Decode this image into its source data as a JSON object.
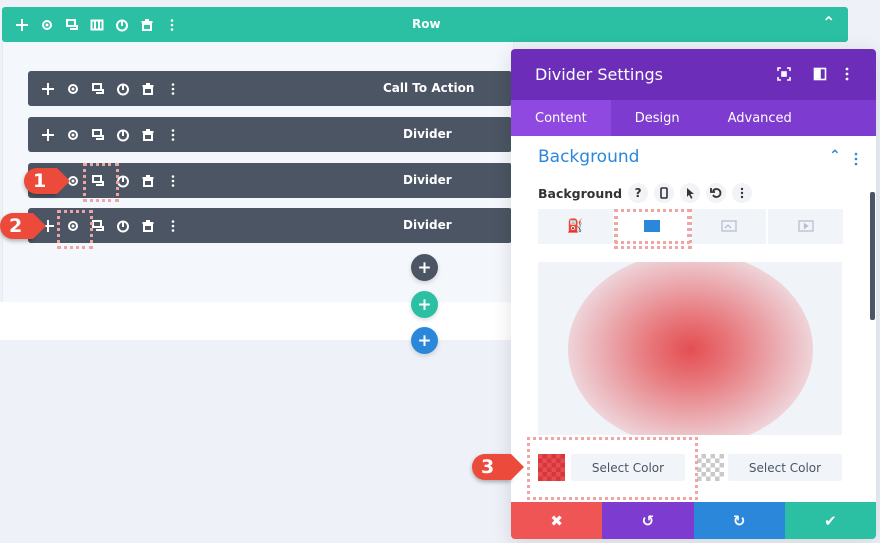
{
  "row": {
    "label": "Row",
    "color": "#2bbfa3",
    "icons": [
      "move-icon",
      "gear-icon",
      "duplicate-icon",
      "columns-icon",
      "power-icon",
      "trash-icon",
      "more-icon"
    ]
  },
  "modules": [
    {
      "label": "Call To Action"
    },
    {
      "label": "Divider"
    },
    {
      "label": "Divider"
    },
    {
      "label": "Divider"
    }
  ],
  "add_buttons": [
    {
      "label": "+",
      "color": "#4b5563",
      "kind": "add-module"
    },
    {
      "label": "+",
      "color": "#2bbfa3",
      "kind": "add-row"
    },
    {
      "label": "+",
      "color": "#2b87da",
      "kind": "add-section"
    }
  ],
  "markers": [
    "1",
    "2",
    "3"
  ],
  "panel": {
    "title": "Divider Settings",
    "tabs": [
      "Content",
      "Design",
      "Advanced"
    ],
    "active_tab": "Content",
    "section_title": "Background",
    "option_label": "Background",
    "option_help": "?",
    "bg_tabs": [
      "color",
      "gradient",
      "image",
      "video"
    ],
    "active_bg_tab": "gradient",
    "color_stops": [
      {
        "label": "Select Color",
        "color": "#e44e52"
      },
      {
        "label": "Select Color",
        "color": "transparent"
      }
    ],
    "footer": {
      "cancel": "✖",
      "undo": "↺",
      "redo": "↻",
      "save": "✔"
    }
  }
}
